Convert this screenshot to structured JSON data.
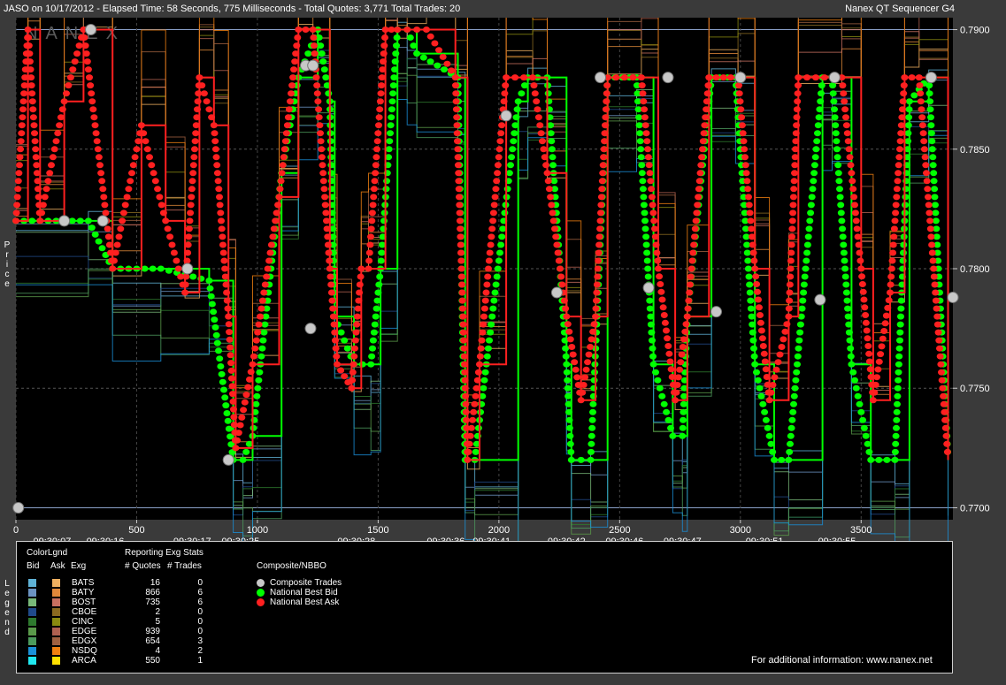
{
  "header": {
    "left": "JASO on 10/17/2012  -  Elapsed Time: 58 Seconds, 775 Milliseconds  -  Total Quotes: 3,771  Total Trades: 20",
    "right": "Nanex QT Sequencer G4"
  },
  "side_labels": {
    "price": "Price",
    "legend": "Legend"
  },
  "watermark": "NANEX",
  "chart_data": {
    "type": "line",
    "ylabel": "Price",
    "xlim": [
      0,
      3880
    ],
    "ylim": [
      0.7695,
      0.7905
    ],
    "y_ticks": [
      "0.7700",
      "0.7750",
      "0.7800",
      "0.7850",
      "0.7900"
    ],
    "y_tick_values": [
      0.77,
      0.775,
      0.78,
      0.785,
      0.79
    ],
    "x_ticks": [
      0,
      500,
      1000,
      1500,
      2000,
      2500,
      3000,
      3500
    ],
    "time_labels": [
      {
        "x": 150,
        "label": "09:30:07"
      },
      {
        "x": 370,
        "label": "09:30:16"
      },
      {
        "x": 730,
        "label": "09:30:17"
      },
      {
        "x": 930,
        "label": "09:30:25"
      },
      {
        "x": 1410,
        "label": "09:30:28"
      },
      {
        "x": 1780,
        "label": "09:30:36"
      },
      {
        "x": 1970,
        "label": "09:30:41"
      },
      {
        "x": 2280,
        "label": "09:30:42"
      },
      {
        "x": 2520,
        "label": "09:30:46"
      },
      {
        "x": 2760,
        "label": "09:30:47"
      },
      {
        "x": 3100,
        "label": "09:30:51"
      },
      {
        "x": 3400,
        "label": "09:30:55"
      }
    ],
    "series": [
      {
        "name": "National Best Bid",
        "color": "#00ff00",
        "x": [
          0,
          300,
          400,
          600,
          800,
          900,
          940,
          980,
          1100,
          1170,
          1250,
          1300,
          1320,
          1400,
          1470,
          1510,
          1580,
          1620,
          1660,
          1830,
          1860,
          1900,
          2080,
          2120,
          2200,
          2280,
          2300,
          2380,
          2450,
          2570,
          2640,
          2720,
          2760,
          2780,
          2880,
          2980,
          3060,
          3140,
          3200,
          3340,
          3380,
          3460,
          3540,
          3640,
          3700,
          3780,
          3860
        ],
        "y": [
          0.782,
          0.782,
          0.78,
          0.78,
          0.7795,
          0.772,
          0.772,
          0.773,
          0.784,
          0.788,
          0.79,
          0.787,
          0.778,
          0.776,
          0.776,
          0.78,
          0.79,
          0.79,
          0.789,
          0.788,
          0.772,
          0.772,
          0.787,
          0.788,
          0.788,
          0.776,
          0.772,
          0.772,
          0.788,
          0.788,
          0.776,
          0.773,
          0.773,
          0.778,
          0.788,
          0.788,
          0.776,
          0.772,
          0.772,
          0.788,
          0.788,
          0.776,
          0.772,
          0.772,
          0.787,
          0.788,
          0.772
        ]
      },
      {
        "name": "National Best Ask",
        "color": "#ff2020",
        "x": [
          0,
          50,
          100,
          200,
          280,
          400,
          520,
          620,
          700,
          760,
          820,
          880,
          910,
          980,
          1090,
          1170,
          1230,
          1300,
          1330,
          1390,
          1430,
          1460,
          1530,
          1580,
          1620,
          1700,
          1820,
          1870,
          1920,
          2030,
          2140,
          2200,
          2280,
          2340,
          2400,
          2450,
          2590,
          2660,
          2730,
          2780,
          2870,
          2990,
          3060,
          3120,
          3200,
          3240,
          3420,
          3500,
          3550,
          3620,
          3680,
          3740,
          3860
        ],
        "y": [
          0.782,
          0.79,
          0.782,
          0.787,
          0.79,
          0.78,
          0.786,
          0.782,
          0.779,
          0.788,
          0.786,
          0.778,
          0.7725,
          0.776,
          0.783,
          0.79,
          0.79,
          0.78,
          0.776,
          0.775,
          0.78,
          0.78,
          0.79,
          0.79,
          0.79,
          0.79,
          0.788,
          0.772,
          0.776,
          0.788,
          0.788,
          0.784,
          0.778,
          0.7745,
          0.778,
          0.788,
          0.788,
          0.78,
          0.7745,
          0.778,
          0.788,
          0.788,
          0.78,
          0.7745,
          0.778,
          0.788,
          0.788,
          0.78,
          0.7745,
          0.779,
          0.788,
          0.788,
          0.772
        ]
      },
      {
        "name": "Composite Trades",
        "color": "#c8c8c8",
        "style": "points",
        "x": [
          10,
          200,
          360,
          310,
          710,
          880,
          1200,
          1220,
          1230,
          2030,
          2240,
          2420,
          2620,
          2700,
          2900,
          3000,
          3330,
          3390,
          3790,
          3880
        ],
        "y": [
          0.77,
          0.782,
          0.782,
          0.79,
          0.78,
          0.772,
          0.7885,
          0.7775,
          0.7885,
          0.7864,
          0.779,
          0.788,
          0.7792,
          0.788,
          0.7782,
          0.788,
          0.7787,
          0.788,
          0.788,
          0.7788
        ]
      }
    ]
  },
  "legend": {
    "header_colorlgnd": "ColorLgnd",
    "header_reporting": "Reporting Exg Stats",
    "col_bid": "Bid",
    "col_ask": "Ask",
    "col_exg": "Exg",
    "col_quotes": "# Quotes",
    "col_trades": "# Trades",
    "composite_header": "Composite/NBBO",
    "exchanges": [
      {
        "exg": "BATS",
        "quotes": "16",
        "trades": "0",
        "bid": "#5fb2d6",
        "ask": "#f0b060"
      },
      {
        "exg": "BATY",
        "quotes": "866",
        "trades": "6",
        "bid": "#6c93c2",
        "ask": "#e0883a"
      },
      {
        "exg": "BOST",
        "quotes": "735",
        "trades": "6",
        "bid": "#78b878",
        "ask": "#c87060"
      },
      {
        "exg": "CBOE",
        "quotes": "2",
        "trades": "0",
        "bid": "#204a8a",
        "ask": "#8a6a20"
      },
      {
        "exg": "CINC",
        "quotes": "5",
        "trades": "0",
        "bid": "#2e7a2e",
        "ask": "#8a8a10"
      },
      {
        "exg": "EDGE",
        "quotes": "939",
        "trades": "0",
        "bid": "#5a9a4a",
        "ask": "#b06050"
      },
      {
        "exg": "EDGX",
        "quotes": "654",
        "trades": "3",
        "bid": "#4c9a5c",
        "ask": "#a06040"
      },
      {
        "exg": "NSDQ",
        "quotes": "4",
        "trades": "2",
        "bid": "#1a90d8",
        "ask": "#f08010"
      },
      {
        "exg": "ARCA",
        "quotes": "550",
        "trades": "1",
        "bid": "#20e8f0",
        "ask": "#ffe000"
      }
    ],
    "composite": [
      {
        "label": "Composite Trades",
        "color": "#c8c8c8"
      },
      {
        "label": "National Best Bid",
        "color": "#00ff00"
      },
      {
        "label": "National Best Ask",
        "color": "#ff2020"
      }
    ],
    "footer": "For additional information: www.nanex.net"
  }
}
